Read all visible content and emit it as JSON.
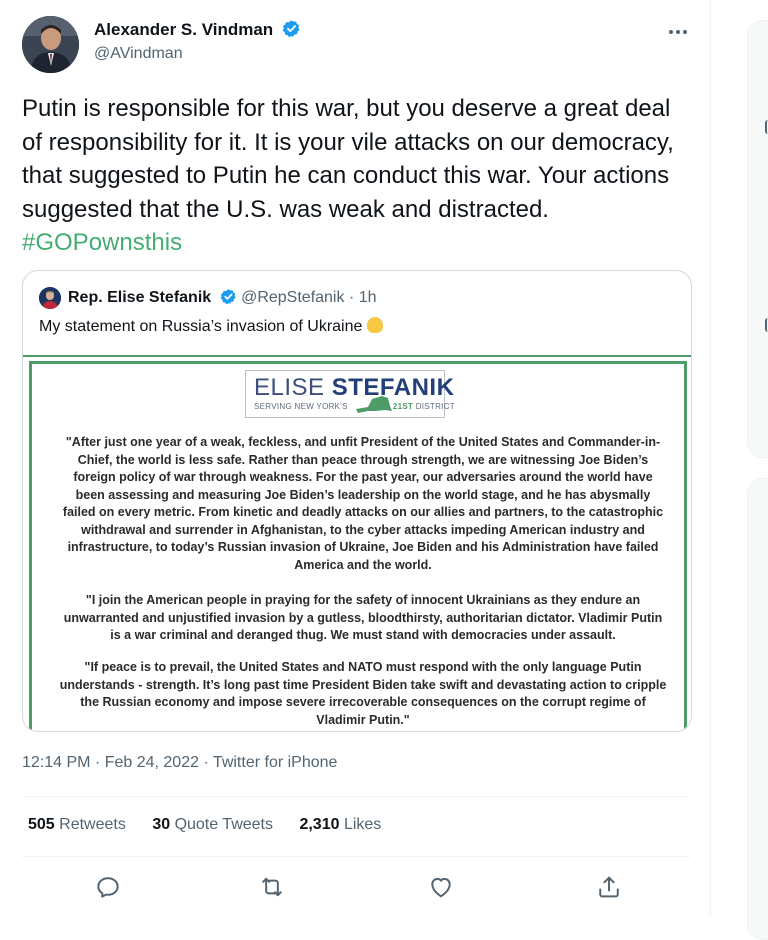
{
  "tweet": {
    "author_name": "Alexander S. Vindman",
    "author_handle": "@AVindman",
    "text": "Putin is responsible for this war, but you deserve a great deal of responsibility for it. It is your vile attacks on our democracy, that suggested to Putin he can conduct this war. Your actions suggested that the U.S. was weak and distracted.",
    "hashtag": "#GOPownsthis",
    "timestamp": "12:14 PM · Feb 24, 2022 · Twitter for iPhone",
    "more_icon": "more-icon"
  },
  "quoted": {
    "author_name": "Rep. Elise Stefanik",
    "author_handle": "@RepStefanik",
    "time": "· 1h",
    "text": "My statement on Russia’s invasion of Ukraine",
    "emoji": "backhand-index-pointing-down"
  },
  "statement": {
    "logo_first": "ELISE",
    "logo_last": "STEFANIK",
    "logo_sub_prefix": "SERVING NEW YORK'S",
    "logo_sub_district_num": "21ST",
    "logo_sub_district": "DISTRICT",
    "para1": "\"After just one year of a weak, feckless, and unfit President of the United States and Commander-in-Chief, the world is less safe. Rather than peace through strength, we are witnessing Joe Biden’s foreign policy of war through weakness. For the past year, our adversaries around the world have been assessing and measuring Joe Biden’s leadership on the world stage, and he has abysmally failed on every metric. From kinetic and deadly attacks on our allies and partners, to the catastrophic withdrawal and surrender in Afghanistan, to the cyber attacks impeding American industry and infrastructure, to today’s Russian invasion of Ukraine, Joe Biden and his Administration have failed America and the world.",
    "para2": "\"I join the American people in praying for the safety of innocent Ukrainians as they endure an unwarranted and unjustified invasion by a gutless, bloodthirsty, authoritarian dictator. Vladimir Putin is a war criminal and deranged thug. We must stand with democracies under assault.",
    "para3": "\"If peace is to prevail, the United States and NATO must respond with the only language Putin understands - strength. It’s long past time President Biden take swift and devastating action to cripple the Russian economy and impose severe irrecoverable consequences on the corrupt regime of Vladimir Putin.\""
  },
  "stats": {
    "retweets_count": "505",
    "retweets_label": "Retweets",
    "quotes_count": "30",
    "quotes_label": "Quote Tweets",
    "likes_count": "2,310",
    "likes_label": "Likes"
  },
  "actions": [
    "reply-icon",
    "retweet-icon",
    "like-icon",
    "share-icon"
  ],
  "colors": {
    "hashtag": "#44ad73",
    "verified": "#1d9bf0",
    "secondary_text": "#536471",
    "statement_border": "#4e9d68",
    "logo_navy": "#233f7a"
  }
}
